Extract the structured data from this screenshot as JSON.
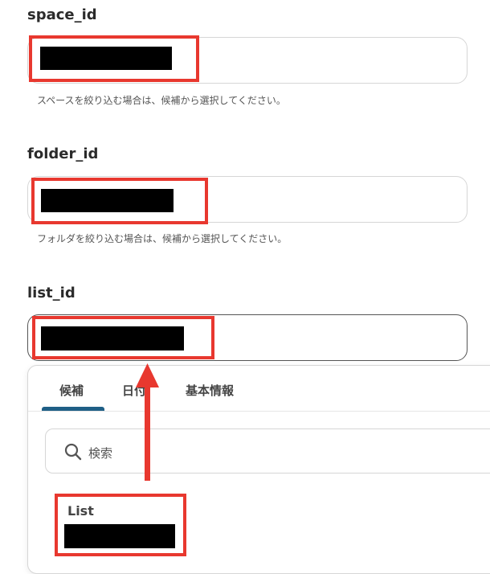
{
  "fields": [
    {
      "label": "space_id",
      "hint": "スペースを絞り込む場合は、候補から選択してください。"
    },
    {
      "label": "folder_id",
      "hint": "フォルダを絞り込む場合は、候補から選択してください。"
    },
    {
      "label": "list_id",
      "hint": ""
    }
  ],
  "dropdown": {
    "tabs": [
      {
        "label": "候補",
        "active": true
      },
      {
        "label": "日付",
        "active": false
      },
      {
        "label": "基本情報",
        "active": false
      }
    ],
    "search_placeholder": "検索",
    "options": [
      {
        "label": "List"
      }
    ]
  },
  "icons": {
    "search": "search-icon",
    "arrow": "arrow-up-icon"
  },
  "colors": {
    "highlight": "#e8382f",
    "active_tab": "#1f5f86",
    "redaction": "#000000"
  }
}
